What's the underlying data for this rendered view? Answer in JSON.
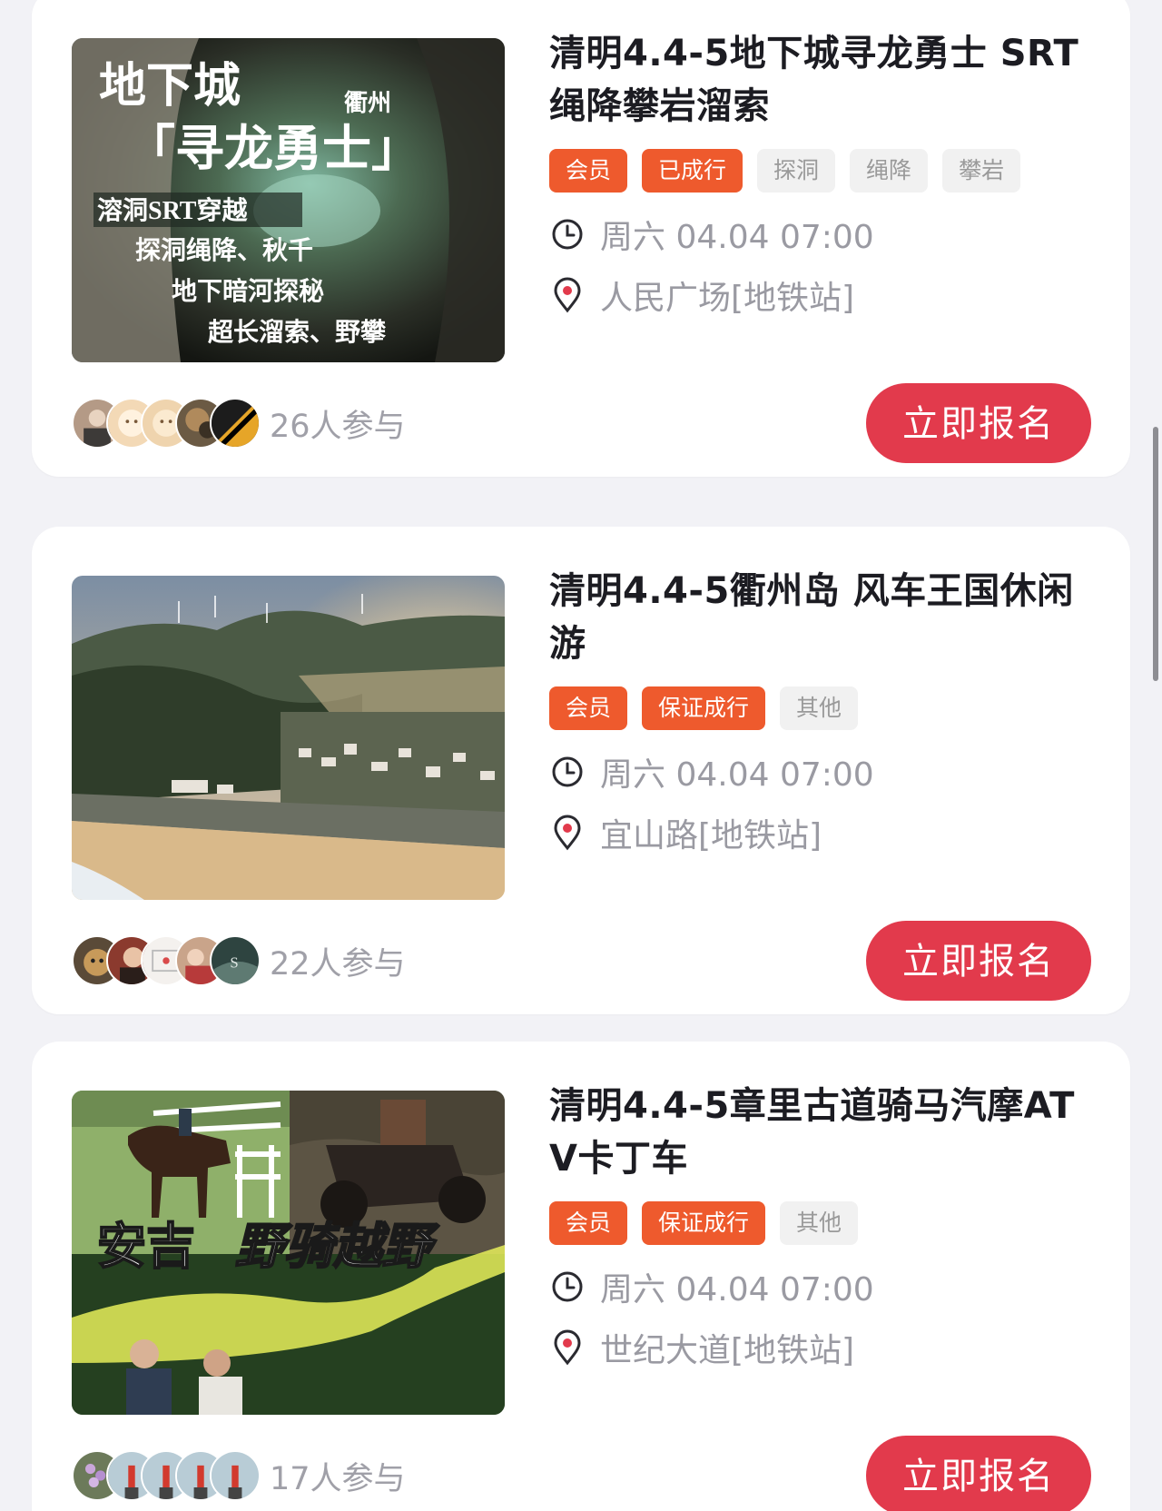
{
  "activities": [
    {
      "title": "清明4.4-5地下城寻龙勇士 SRT绳降攀岩溜索",
      "tags": [
        "会员",
        "已成行",
        "探洞",
        "绳降",
        "攀岩"
      ],
      "time": "周六 04.04 07:00",
      "location": "人民广场[地铁站]",
      "participants": "26人参与",
      "signup_label": "立即报名",
      "image_text": [
        "地下城",
        "衢州",
        "「寻龙勇士」",
        "溶洞SRT穿越",
        "探洞绳降、秋千",
        "地下暗河探秘",
        "超长溜索、野攀"
      ]
    },
    {
      "title": "清明4.4-5衢州岛 风车王国休闲游",
      "tags": [
        "会员",
        "保证成行",
        "其他"
      ],
      "time": "周六 04.04 07:00",
      "location": "宜山路[地铁站]",
      "participants": "22人参与",
      "signup_label": "立即报名"
    },
    {
      "title": "清明4.4-5章里古道骑马汽摩ATV卡丁车",
      "tags": [
        "会员",
        "保证成行",
        "其他"
      ],
      "time": "周六 04.04 07:00",
      "location": "世纪大道[地铁站]",
      "participants": "17人参与",
      "signup_label": "立即报名",
      "image_text": [
        "安吉",
        "野骑越野"
      ]
    }
  ],
  "colors": {
    "tag_orange": "#ee5a2d",
    "signup_red": "#e23a4c",
    "muted_text": "#9a9aa2"
  },
  "icons": [
    "clock-icon",
    "location-pin-icon"
  ]
}
